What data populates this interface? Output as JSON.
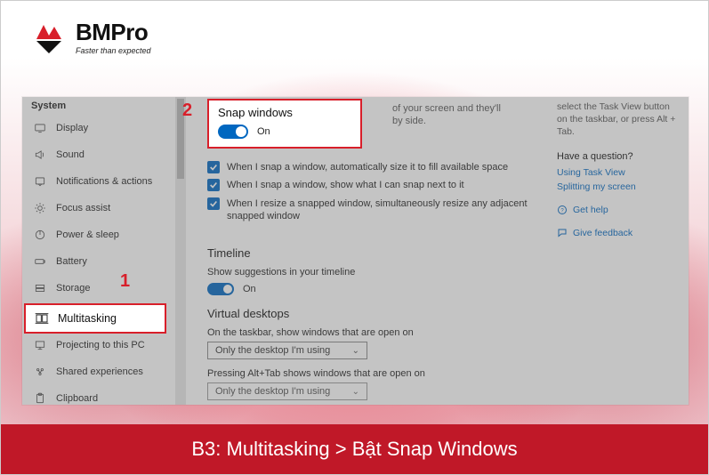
{
  "logo": {
    "brand": "BMPro",
    "tagline": "Faster than expected"
  },
  "caption": "B3: Multitasking > Bật Snap Windows",
  "callouts": {
    "one": "1",
    "two": "2"
  },
  "window": {
    "title": "System",
    "sidebar": [
      {
        "icon": "display",
        "label": "Display"
      },
      {
        "icon": "sound",
        "label": "Sound"
      },
      {
        "icon": "notifications",
        "label": "Notifications & actions"
      },
      {
        "icon": "focus",
        "label": "Focus assist"
      },
      {
        "icon": "power",
        "label": "Power & sleep"
      },
      {
        "icon": "battery",
        "label": "Battery"
      },
      {
        "icon": "storage",
        "label": "Storage"
      },
      {
        "icon": "multitasking",
        "label": "Multitasking",
        "active": true
      },
      {
        "icon": "projecting",
        "label": "Projecting to this PC"
      },
      {
        "icon": "shared",
        "label": "Shared experiences"
      },
      {
        "icon": "clipboard",
        "label": "Clipboard"
      }
    ],
    "snap": {
      "title": "Snap windows",
      "state_label": "On",
      "partial_hint_line1": "of your screen and they'll",
      "partial_hint_line2": "by side.",
      "options": [
        "When I snap a window, automatically size it to fill available space",
        "When I snap a window, show what I can snap next to it",
        "When I resize a snapped window, simultaneously resize any adjacent snapped window"
      ]
    },
    "timeline": {
      "heading": "Timeline",
      "desc": "Show suggestions in your timeline",
      "state_label": "On"
    },
    "virtual_desktops": {
      "heading": "Virtual desktops",
      "taskbar_label": "On the taskbar, show windows that are open on",
      "taskbar_value": "Only the desktop I'm using",
      "alttab_label": "Pressing Alt+Tab shows windows that are open on",
      "alttab_value": "Only the desktop I'm using"
    },
    "right": {
      "tip": "select the Task View button on the taskbar, or press Alt + Tab.",
      "question": "Have a question?",
      "links": [
        "Using Task View",
        "Splitting my screen"
      ],
      "help": "Get help",
      "feedback": "Give feedback"
    }
  }
}
